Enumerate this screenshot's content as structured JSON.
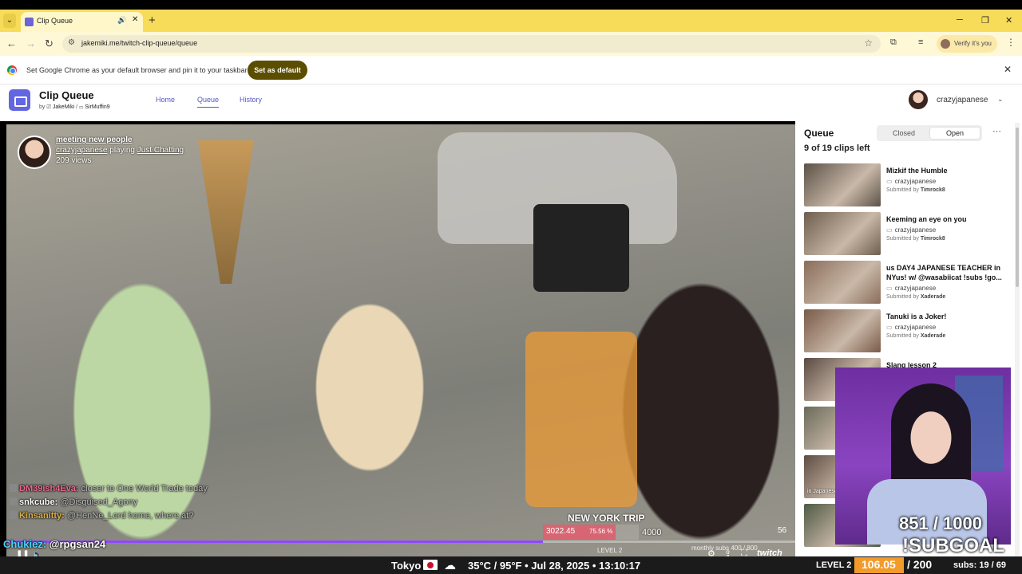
{
  "browser": {
    "tab_title": "Clip Queue",
    "url": "jakemiki.me/twitch-clip-queue/queue",
    "verify_label": "Verify it's you",
    "infobar_message": "Set Google Chrome as your default browser and pin it to your taskbar",
    "set_default_label": "Set as default"
  },
  "app": {
    "name": "Clip Queue",
    "credits_by": "by",
    "author1": "JakeMiki",
    "author2": "SirMuffin9",
    "nav": [
      {
        "label": "Home",
        "active": false
      },
      {
        "label": "Queue",
        "active": true
      },
      {
        "label": "History",
        "active": false
      }
    ],
    "user": "crazyjapanese"
  },
  "player": {
    "clip_title": "meeting new people",
    "channel": "crazyjapanese",
    "playing_word": "playing",
    "category": "Just Chatting",
    "views": "209 views",
    "chat": [
      {
        "name": "DM39ish4Eva:",
        "msg": "closer to One World Trade today"
      },
      {
        "name": "snkcube:",
        "msg": "@Disguised_Agony"
      },
      {
        "name": "Kinsanitty:",
        "msg": "@HenNe_Lord home, where at?"
      }
    ],
    "overlay_trip": "NEW YORK TRIP",
    "bits_value": "3022.45",
    "bits_percent": "75.56 %",
    "bits_fraction": 0.7556,
    "bits_goal": "4000",
    "level_small": "LEVEL 2",
    "monthly": "monthly subs 400 / 800",
    "clip_number": "56",
    "progress_fraction": 0.68
  },
  "queue": {
    "title": "Queue",
    "closed_label": "Closed",
    "open_label": "Open",
    "count_text": "9 of 19 clips left",
    "items": [
      {
        "title": "Mizkif the Humble",
        "channel": "crazyjapanese",
        "submitted_prefix": "Submitted by",
        "submitter": "Timrock8",
        "thumb": "#5c5248"
      },
      {
        "title": "Keeming an eye on you",
        "channel": "crazyjapanese",
        "submitted_prefix": "Submitted by",
        "submitter": "Timrock8",
        "thumb": "#6e5e4e"
      },
      {
        "title": "us DAY4 JAPANESE TEACHER in NYus! w/ @wasabiicat !subs !go...",
        "channel": "crazyjapanese",
        "submitted_prefix": "Submitted by",
        "submitter": "Xaderade",
        "thumb": "#8a6d5a"
      },
      {
        "title": "Tanuki is a Joker!",
        "channel": "crazyjapanese",
        "submitted_prefix": "Submitted by",
        "submitter": "Xaderade",
        "thumb": "#7a5a48"
      },
      {
        "title": "Slang lesson 2",
        "channel": "",
        "submitted_prefix": "",
        "submitter": "",
        "thumb": "#5a4a42"
      },
      {
        "title": "",
        "channel": "",
        "submitted_prefix": "",
        "submitter": "",
        "thumb": "#6a6a5a"
      },
      {
        "title": "",
        "channel": "",
        "submitted_prefix": "",
        "submitter": "",
        "thumb": "#5d4c40"
      },
      {
        "title": "",
        "channel": "",
        "submitted_prefix": "",
        "submitter": "",
        "thumb": "#4e5a44"
      }
    ],
    "thumb_caption": "in Japanese"
  },
  "chat_bottom": {
    "name": "Chukiez:",
    "msg": "@rpgsan24"
  },
  "subgoal": {
    "count": "851  /  1000",
    "label": "!SUBGOAL"
  },
  "streambar": {
    "city": "Tokyo",
    "weather": "35°C / 95°F • Jul 28, 2025 • 13:10:17",
    "level": "LEVEL 2",
    "bits": "106.05",
    "goal": "/  200",
    "subs": "subs: 19 / 69"
  },
  "colors": {
    "accent": "#6366e1",
    "tabbar": "#f7dc5a",
    "bits_orange": "#f29b2a"
  }
}
